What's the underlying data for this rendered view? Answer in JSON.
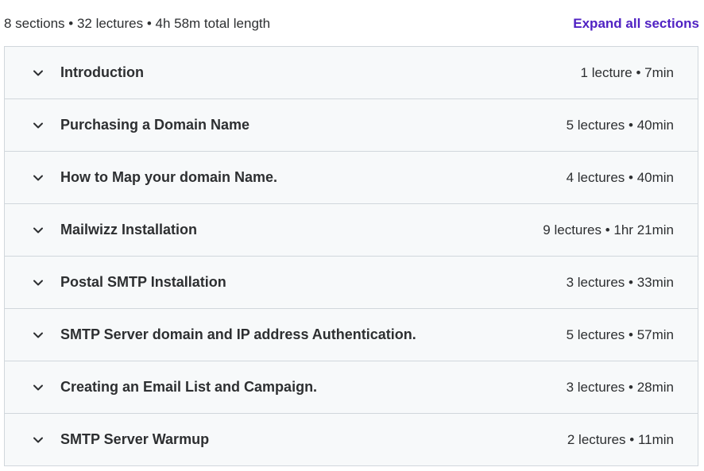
{
  "summary": {
    "text": "8 sections • 32 lectures • 4h 58m total length",
    "expand_label": "Expand all sections"
  },
  "sections": [
    {
      "title": "Introduction",
      "meta": "1 lecture • 7min"
    },
    {
      "title": "Purchasing a Domain Name",
      "meta": "5 lectures • 40min"
    },
    {
      "title": "How to Map your domain Name.",
      "meta": "4 lectures • 40min"
    },
    {
      "title": "Mailwizz Installation",
      "meta": "9 lectures • 1hr 21min"
    },
    {
      "title": "Postal SMTP Installation",
      "meta": "3 lectures • 33min"
    },
    {
      "title": "SMTP Server domain and IP address Authentication.",
      "meta": "5 lectures • 57min"
    },
    {
      "title": "Creating an Email List and Campaign.",
      "meta": "3 lectures • 28min"
    },
    {
      "title": "SMTP Server Warmup",
      "meta": "2 lectures • 11min"
    }
  ],
  "icons": {
    "section_toggle": "chevron-down-icon"
  },
  "colors": {
    "text": "#2d2f31",
    "link": "#5022c3",
    "row_background": "#f7f9fa",
    "border": "#d1d7dc"
  }
}
